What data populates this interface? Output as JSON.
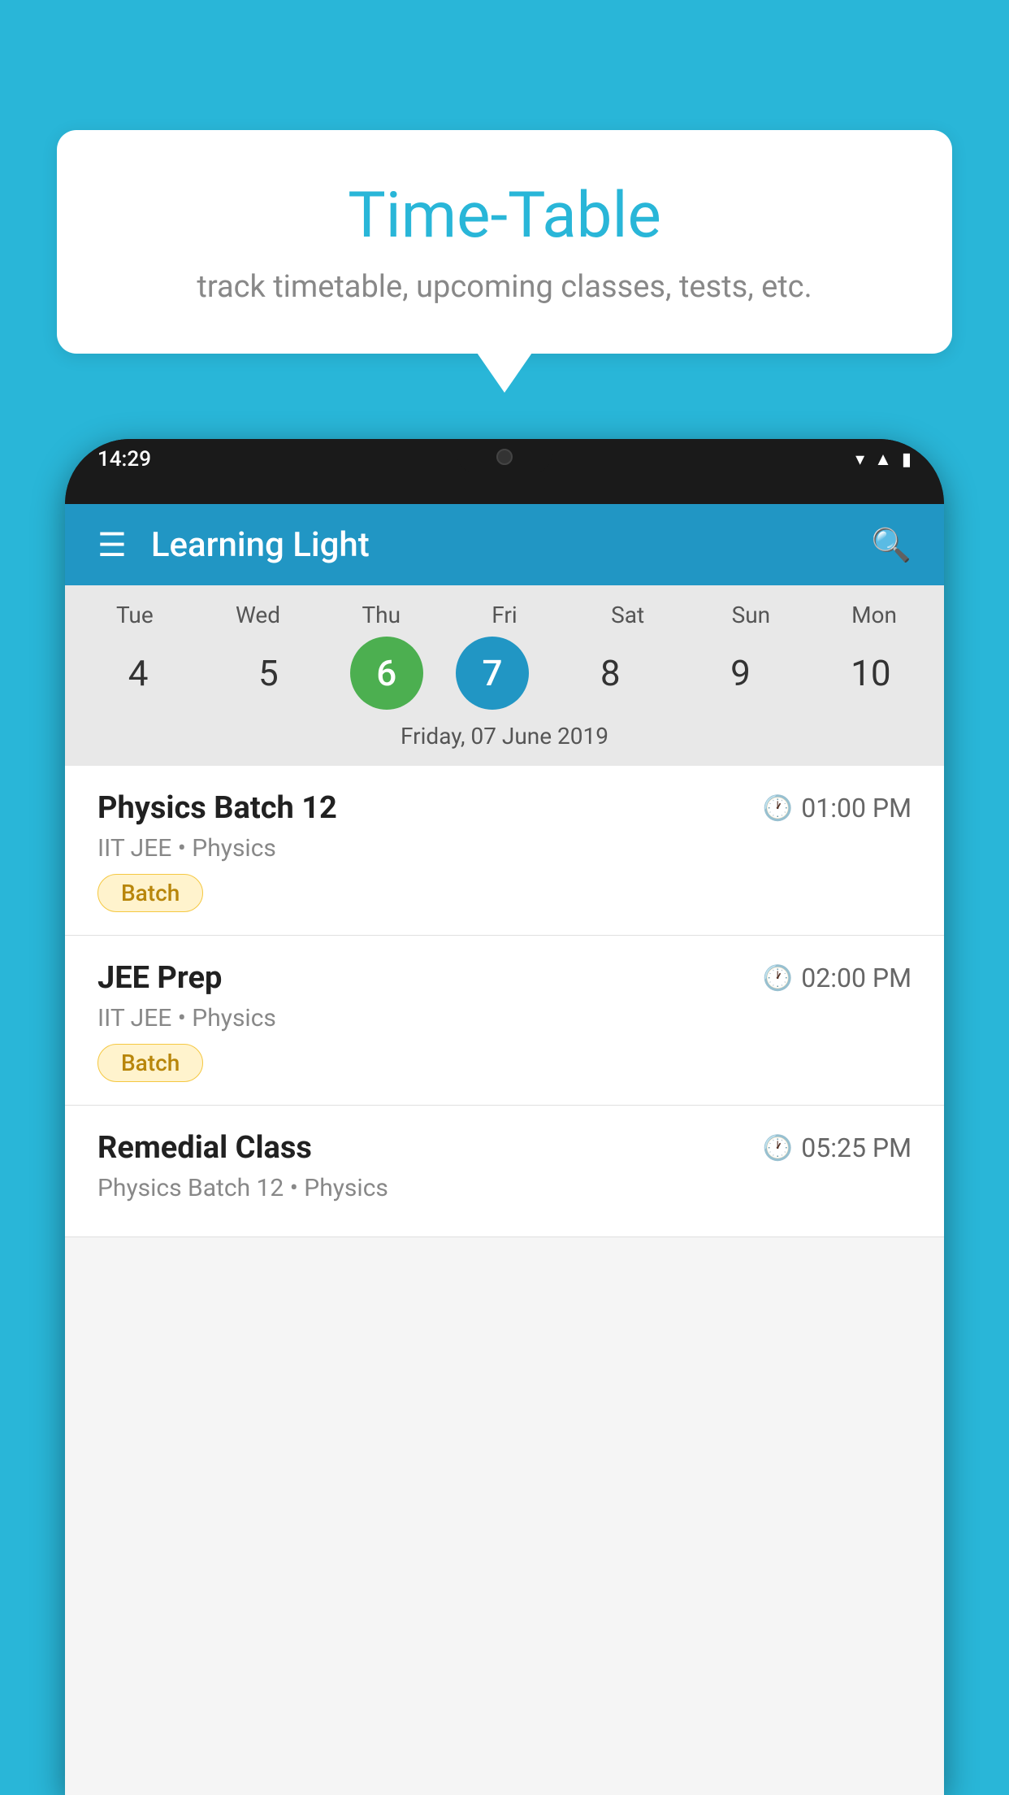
{
  "background_color": "#29B6D8",
  "bubble": {
    "title": "Time-Table",
    "subtitle": "track timetable, upcoming classes, tests, etc."
  },
  "phone": {
    "status_bar": {
      "time": "14:29"
    },
    "app_header": {
      "title": "Learning Light"
    },
    "calendar": {
      "day_headers": [
        "Tue",
        "Wed",
        "Thu",
        "Fri",
        "Sat",
        "Sun",
        "Mon"
      ],
      "day_numbers": [
        {
          "num": "4",
          "state": "normal"
        },
        {
          "num": "5",
          "state": "normal"
        },
        {
          "num": "6",
          "state": "today"
        },
        {
          "num": "7",
          "state": "selected"
        },
        {
          "num": "8",
          "state": "normal"
        },
        {
          "num": "9",
          "state": "normal"
        },
        {
          "num": "10",
          "state": "normal"
        }
      ],
      "selected_date_label": "Friday, 07 June 2019"
    },
    "schedule_items": [
      {
        "title": "Physics Batch 12",
        "time": "01:00 PM",
        "subtitle": "IIT JEE • Physics",
        "badge": "Batch"
      },
      {
        "title": "JEE Prep",
        "time": "02:00 PM",
        "subtitle": "IIT JEE • Physics",
        "badge": "Batch"
      },
      {
        "title": "Remedial Class",
        "time": "05:25 PM",
        "subtitle": "Physics Batch 12 • Physics",
        "badge": null
      }
    ]
  }
}
